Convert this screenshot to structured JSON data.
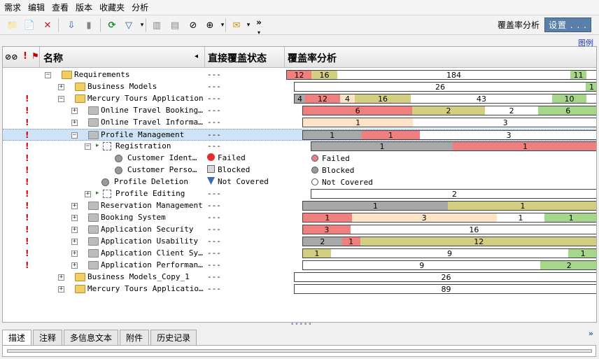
{
  "menu": [
    "需求",
    "编辑",
    "查看",
    "版本",
    "收藏夹",
    "分析"
  ],
  "toolbar": {
    "coverage_label": "覆盖率分析",
    "settings_button": "设置 . . .",
    "overflow": "»"
  },
  "legend_link": "图例",
  "grid": {
    "col_name": "名称",
    "col_status": "直接覆盖状态",
    "col_analysis": "覆盖率分析",
    "sort_arrow": "◂",
    "rows": [
      {
        "name": "Requirements",
        "status": "---",
        "flag": false,
        "pm": "−",
        "icon": "folder",
        "selected": false,
        "bar": [
          {
            "v": "12",
            "c": "#f08080"
          },
          {
            "v": "16",
            "c": "#d2cf82"
          },
          {
            "v": "184",
            "c": "#ffffff"
          },
          {
            "v": "11",
            "c": "#a6d68a"
          }
        ]
      },
      {
        "name": "Business Models",
        "status": "---",
        "flag": false,
        "pm": "+",
        "icon": "folder",
        "selected": false,
        "bar": [
          {
            "v": "26",
            "c": "#ffffff"
          },
          {
            "v": "1",
            "c": "#a6d68a"
          }
        ]
      },
      {
        "name": "Mercury Tours Application",
        "status": "---",
        "flag": true,
        "pm": "−",
        "icon": "folder",
        "selected": false,
        "bar": [
          {
            "v": "4",
            "c": "#a8a8a8"
          },
          {
            "v": "12",
            "c": "#f08080"
          },
          {
            "v": "4",
            "c": "#fde3c8"
          },
          {
            "v": "16",
            "c": "#d2cf82"
          },
          {
            "v": "43",
            "c": "#ffffff"
          },
          {
            "v": "10",
            "c": "#a6d68a"
          }
        ]
      },
      {
        "name": "Online Travel Booking…",
        "status": "---",
        "flag": true,
        "pm": "+",
        "icon": "gfolder",
        "selected": false,
        "bar": [
          {
            "v": "6",
            "c": "#f08080"
          },
          {
            "v": "2",
            "c": "#d2cf82"
          },
          {
            "v": "2",
            "c": "#ffffff"
          },
          {
            "v": "6",
            "c": "#a6d68a"
          }
        ]
      },
      {
        "name": "Online Travel Informa…",
        "status": "---",
        "flag": true,
        "pm": "+",
        "icon": "gfolder",
        "selected": false,
        "bar": [
          {
            "v": "1",
            "c": "#fde3c8"
          },
          {
            "v": "3",
            "c": "#ffffff"
          }
        ]
      },
      {
        "name": "Profile Management",
        "status": "---",
        "flag": true,
        "pm": "−",
        "icon": "gfolder",
        "selected": true,
        "bar": [
          {
            "v": "1",
            "c": "#a8a8a8"
          },
          {
            "v": "1",
            "c": "#f08080"
          },
          {
            "v": "3",
            "c": "#ffffff"
          }
        ]
      },
      {
        "name": "Registration",
        "status": "---",
        "flag": true,
        "pm": "−",
        "icon": "req",
        "selected": false,
        "bar": [
          {
            "v": "1",
            "c": "#a8a8a8"
          },
          {
            "v": "1",
            "c": "#f08080"
          }
        ]
      },
      {
        "name": "Customer Ident…",
        "status": "Failed",
        "flag": true,
        "pm": "",
        "icon": "circ",
        "selected": false,
        "bar": []
      },
      {
        "name": "Customer Perso…",
        "status": "Blocked",
        "flag": true,
        "pm": "",
        "icon": "circ",
        "selected": false,
        "bar": []
      },
      {
        "name": "Profile Deletion",
        "status": "Not Covered",
        "flag": true,
        "pm": "",
        "icon": "circ",
        "selected": false,
        "bar": []
      },
      {
        "name": "Profile Editing",
        "status": "---",
        "flag": true,
        "pm": "+",
        "icon": "req",
        "selected": false,
        "bar": [
          {
            "v": "2",
            "c": "#ffffff"
          }
        ]
      },
      {
        "name": "Reservation Management",
        "status": "---",
        "flag": true,
        "pm": "+",
        "icon": "gfolder",
        "selected": false,
        "bar": [
          {
            "v": "1",
            "c": "#a8a8a8"
          },
          {
            "v": "1",
            "c": "#d2cf82"
          }
        ]
      },
      {
        "name": "Booking System",
        "status": "---",
        "flag": true,
        "pm": "+",
        "icon": "gfolder",
        "selected": false,
        "bar": [
          {
            "v": "1",
            "c": "#f08080"
          },
          {
            "v": "3",
            "c": "#fde3c8"
          },
          {
            "v": "1",
            "c": "#ffffff"
          },
          {
            "v": "1",
            "c": "#a6d68a"
          }
        ]
      },
      {
        "name": "Application Security",
        "status": "---",
        "flag": true,
        "pm": "+",
        "icon": "gfolder",
        "selected": false,
        "bar": [
          {
            "v": "3",
            "c": "#f08080"
          },
          {
            "v": "16",
            "c": "#ffffff"
          }
        ]
      },
      {
        "name": "Application Usability",
        "status": "---",
        "flag": true,
        "pm": "+",
        "icon": "gfolder",
        "selected": false,
        "bar": [
          {
            "v": "2",
            "c": "#a8a8a8"
          },
          {
            "v": "1",
            "c": "#f08080"
          },
          {
            "v": "12",
            "c": "#d2cf82"
          }
        ]
      },
      {
        "name": "Application Client Sy…",
        "status": "---",
        "flag": true,
        "pm": "+",
        "icon": "gfolder",
        "selected": false,
        "bar": [
          {
            "v": "1",
            "c": "#d2cf82"
          },
          {
            "v": "9",
            "c": "#ffffff"
          },
          {
            "v": "1",
            "c": "#a6d68a"
          }
        ]
      },
      {
        "name": "Application Performan…",
        "status": "---",
        "flag": true,
        "pm": "+",
        "icon": "gfolder",
        "selected": false,
        "bar": [
          {
            "v": "9",
            "c": "#ffffff"
          },
          {
            "v": "2",
            "c": "#a6d68a"
          }
        ]
      },
      {
        "name": "Business Models_Copy_1",
        "status": "---",
        "flag": false,
        "pm": "+",
        "icon": "folder",
        "selected": false,
        "bar": [
          {
            "v": "26",
            "c": "#ffffff"
          }
        ]
      },
      {
        "name": "Mercury Tours Applicatio…",
        "status": "---",
        "flag": false,
        "pm": "+",
        "icon": "folder",
        "selected": false,
        "bar": [
          {
            "v": "89",
            "c": "#ffffff"
          }
        ]
      }
    ],
    "status_legend": [
      {
        "label": "Failed",
        "color": "#f08080"
      },
      {
        "label": "Blocked",
        "color": "#9a9a9a"
      },
      {
        "label": "Not Covered",
        "color": "#ffffff"
      }
    ]
  },
  "bottom_tabs": [
    "描述",
    "注释",
    "多信息文本",
    "附件",
    "历史记录"
  ]
}
